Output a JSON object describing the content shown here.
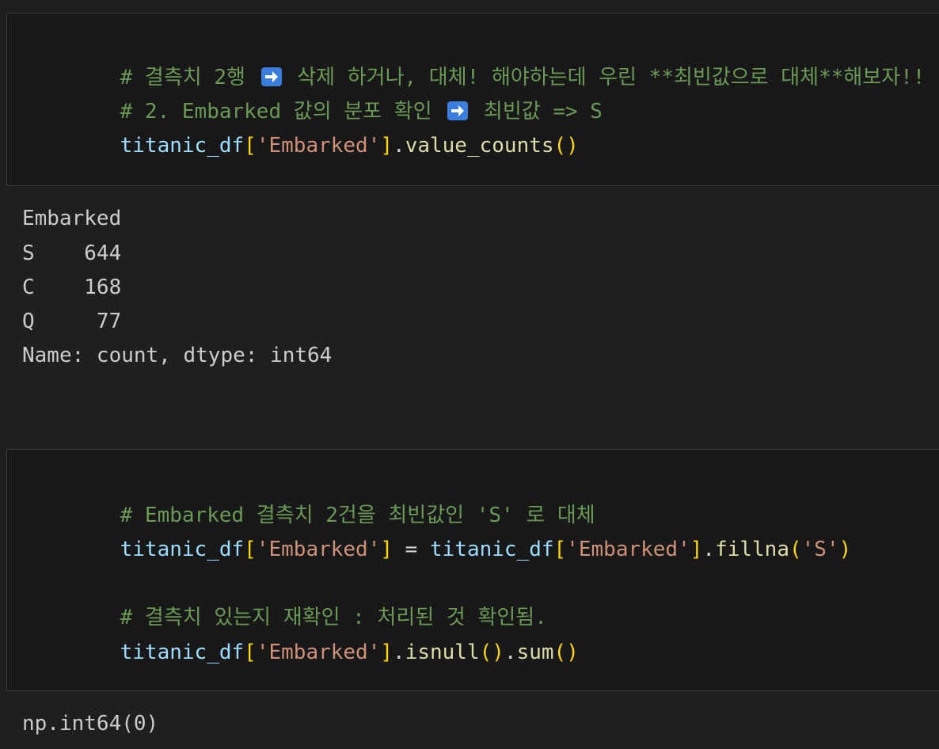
{
  "cell1": {
    "comment1_a": "# 결측치 2행 ",
    "comment1_b": " 삭제 하거나, 대체! 해야하는데 우린 **최빈값으로 대체**해보자!!",
    "comment2_a": "# 2. Embarked 값의 분포 확인 ",
    "comment2_b": " 최빈값 => S",
    "code_var": "titanic_df",
    "code_lbr": "[",
    "code_str": "'Embarked'",
    "code_rbr": "]",
    "code_dot": ".",
    "code_fn": "value_counts",
    "code_parens": "()"
  },
  "output1": {
    "header": "Embarked",
    "rows": [
      {
        "label": "S",
        "value": "644"
      },
      {
        "label": "C",
        "value": "168"
      },
      {
        "label": "Q",
        "value": " 77"
      }
    ],
    "footer": "Name: count, dtype: int64"
  },
  "cell2": {
    "comment1": "# Embarked 결측치 2건을 최빈값인 'S' 로 대체",
    "line2_var1": "titanic_df",
    "line2_lbr1": "[",
    "line2_str1": "'Embarked'",
    "line2_rbr1": "]",
    "line2_eq": " = ",
    "line2_var2": "titanic_df",
    "line2_lbr2": "[",
    "line2_str2": "'Embarked'",
    "line2_rbr2": "]",
    "line2_dot": ".",
    "line2_fn": "fillna",
    "line2_lp": "(",
    "line2_arg": "'S'",
    "line2_rp": ")",
    "comment2": "# 결측치 있는지 재확인 : 처리된 것 확인됨.",
    "line4_var": "titanic_df",
    "line4_lbr": "[",
    "line4_str": "'Embarked'",
    "line4_rbr": "]",
    "line4_dot1": ".",
    "line4_fn1": "isnull",
    "line4_p1": "()",
    "line4_dot2": ".",
    "line4_fn2": "sum",
    "line4_p2": "()"
  },
  "output2": {
    "text": "np.int64(0)"
  },
  "colors": {
    "background": "#1f1f1f",
    "cell_background": "#181818",
    "comment": "#6a9955",
    "variable": "#9cdcfe",
    "string": "#ce9178",
    "bracket": "#ffd700",
    "function": "#dcdcaa",
    "arrow_icon": "#3b7ddd"
  },
  "icons": {
    "arrow": "right-arrow-emoji-icon"
  }
}
